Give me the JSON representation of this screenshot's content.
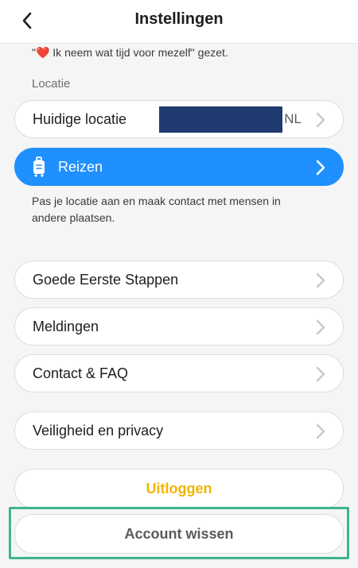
{
  "header": {
    "title": "Instellingen"
  },
  "status": {
    "text": "\"❤️ Ik neem wat tijd voor mezelf\" gezet."
  },
  "location": {
    "section_label": "Locatie",
    "current_label": "Huidige locatie",
    "country": "NL"
  },
  "travel": {
    "label": "Reizen",
    "help": "Pas je locatie aan en maak contact met mensen in andere plaatsen."
  },
  "menu": {
    "items": [
      {
        "label": "Goede Eerste Stappen"
      },
      {
        "label": "Meldingen"
      },
      {
        "label": "Contact & FAQ"
      },
      {
        "label": "Veiligheid en privacy"
      }
    ]
  },
  "account": {
    "logout_label": "Uitloggen",
    "delete_label": "Account wissen"
  },
  "colors": {
    "accent_blue": "#1e90ff",
    "logout_yellow": "#f5b400",
    "highlight_green": "#3fb58a"
  }
}
